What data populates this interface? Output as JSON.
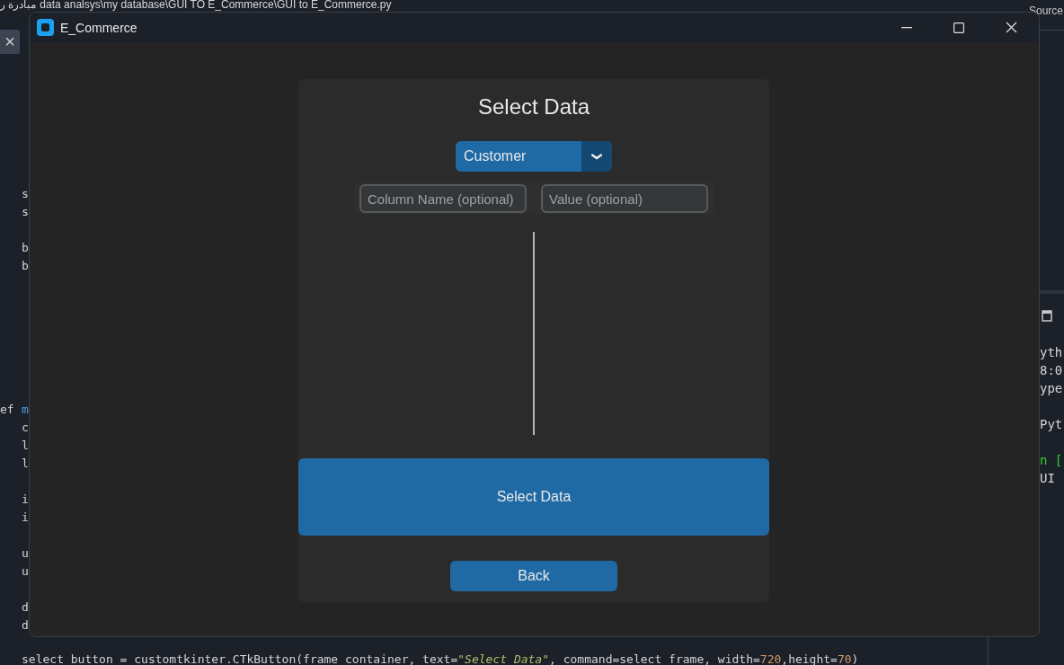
{
  "editor": {
    "path_prefix": "مبادرة ر",
    "path": "data analsys\\my database\\GUI TO E_Commerce\\GUI to E_Commerce.py",
    "tab_close": "×",
    "lines": [
      {
        "text": "s"
      },
      {
        "text": "s"
      },
      {
        "kind": "blank"
      },
      {
        "text": "b"
      },
      {
        "text": "b"
      },
      {
        "kind": "blank"
      },
      {
        "kind": "blank"
      },
      {
        "kind": "blank"
      },
      {
        "kind": "blank"
      },
      {
        "kind": "blank"
      },
      {
        "kind": "blank"
      },
      {
        "kind": "blank"
      },
      {
        "prefix": "ef",
        "text": "m"
      },
      {
        "text": "c"
      },
      {
        "text": "l"
      },
      {
        "text": "l"
      },
      {
        "kind": "blank"
      },
      {
        "text": "i"
      },
      {
        "text": "i"
      },
      {
        "kind": "blank"
      },
      {
        "text": "u"
      },
      {
        "text": "u"
      },
      {
        "kind": "blank"
      },
      {
        "text": "d"
      },
      {
        "text": "d"
      },
      {
        "kind": "blank"
      }
    ],
    "last_line": [
      {
        "kind": "code",
        "text": "select_button = customtkinter.CTkButton(frame_container, text="
      },
      {
        "kind": "string",
        "text": "\"Select Data\""
      },
      {
        "kind": "code",
        "text": ", command=select_frame, width="
      },
      {
        "kind": "number",
        "text": "720"
      },
      {
        "kind": "code",
        "text": ",height="
      },
      {
        "kind": "number",
        "text": "70"
      },
      {
        "kind": "code",
        "text": ")"
      }
    ]
  },
  "side_panel": {
    "header": "Source",
    "console": [
      {
        "kind": "text",
        "text": "yth"
      },
      {
        "kind": "text",
        "text": "8:0"
      },
      {
        "kind": "text",
        "text": "ype"
      },
      {
        "kind": "blank"
      },
      {
        "kind": "text",
        "text": "Pyt"
      },
      {
        "kind": "blank"
      },
      {
        "kind": "prompt",
        "text": "n ["
      },
      {
        "kind": "text",
        "text": "UI"
      }
    ]
  },
  "window": {
    "title": "E_Commerce"
  },
  "panel": {
    "title": "Select Data",
    "table_dropdown": {
      "value": "Customer"
    },
    "filters": [
      {
        "placeholder": "Column Name (optional)"
      },
      {
        "placeholder": "Value (optional)"
      }
    ],
    "primary_button": "Select Data",
    "back_button": "Back"
  }
}
